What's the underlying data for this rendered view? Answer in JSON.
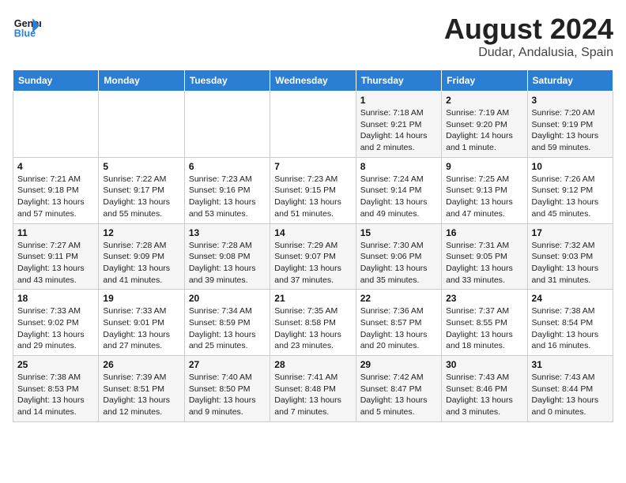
{
  "header": {
    "logo_line1": "General",
    "logo_line2": "Blue",
    "month_year": "August 2024",
    "location": "Dudar, Andalusia, Spain"
  },
  "days_of_week": [
    "Sunday",
    "Monday",
    "Tuesday",
    "Wednesday",
    "Thursday",
    "Friday",
    "Saturday"
  ],
  "weeks": [
    [
      {
        "day": "",
        "info": ""
      },
      {
        "day": "",
        "info": ""
      },
      {
        "day": "",
        "info": ""
      },
      {
        "day": "",
        "info": ""
      },
      {
        "day": "1",
        "info": "Sunrise: 7:18 AM\nSunset: 9:21 PM\nDaylight: 14 hours\nand 2 minutes."
      },
      {
        "day": "2",
        "info": "Sunrise: 7:19 AM\nSunset: 9:20 PM\nDaylight: 14 hours\nand 1 minute."
      },
      {
        "day": "3",
        "info": "Sunrise: 7:20 AM\nSunset: 9:19 PM\nDaylight: 13 hours\nand 59 minutes."
      }
    ],
    [
      {
        "day": "4",
        "info": "Sunrise: 7:21 AM\nSunset: 9:18 PM\nDaylight: 13 hours\nand 57 minutes."
      },
      {
        "day": "5",
        "info": "Sunrise: 7:22 AM\nSunset: 9:17 PM\nDaylight: 13 hours\nand 55 minutes."
      },
      {
        "day": "6",
        "info": "Sunrise: 7:23 AM\nSunset: 9:16 PM\nDaylight: 13 hours\nand 53 minutes."
      },
      {
        "day": "7",
        "info": "Sunrise: 7:23 AM\nSunset: 9:15 PM\nDaylight: 13 hours\nand 51 minutes."
      },
      {
        "day": "8",
        "info": "Sunrise: 7:24 AM\nSunset: 9:14 PM\nDaylight: 13 hours\nand 49 minutes."
      },
      {
        "day": "9",
        "info": "Sunrise: 7:25 AM\nSunset: 9:13 PM\nDaylight: 13 hours\nand 47 minutes."
      },
      {
        "day": "10",
        "info": "Sunrise: 7:26 AM\nSunset: 9:12 PM\nDaylight: 13 hours\nand 45 minutes."
      }
    ],
    [
      {
        "day": "11",
        "info": "Sunrise: 7:27 AM\nSunset: 9:11 PM\nDaylight: 13 hours\nand 43 minutes."
      },
      {
        "day": "12",
        "info": "Sunrise: 7:28 AM\nSunset: 9:09 PM\nDaylight: 13 hours\nand 41 minutes."
      },
      {
        "day": "13",
        "info": "Sunrise: 7:28 AM\nSunset: 9:08 PM\nDaylight: 13 hours\nand 39 minutes."
      },
      {
        "day": "14",
        "info": "Sunrise: 7:29 AM\nSunset: 9:07 PM\nDaylight: 13 hours\nand 37 minutes."
      },
      {
        "day": "15",
        "info": "Sunrise: 7:30 AM\nSunset: 9:06 PM\nDaylight: 13 hours\nand 35 minutes."
      },
      {
        "day": "16",
        "info": "Sunrise: 7:31 AM\nSunset: 9:05 PM\nDaylight: 13 hours\nand 33 minutes."
      },
      {
        "day": "17",
        "info": "Sunrise: 7:32 AM\nSunset: 9:03 PM\nDaylight: 13 hours\nand 31 minutes."
      }
    ],
    [
      {
        "day": "18",
        "info": "Sunrise: 7:33 AM\nSunset: 9:02 PM\nDaylight: 13 hours\nand 29 minutes."
      },
      {
        "day": "19",
        "info": "Sunrise: 7:33 AM\nSunset: 9:01 PM\nDaylight: 13 hours\nand 27 minutes."
      },
      {
        "day": "20",
        "info": "Sunrise: 7:34 AM\nSunset: 8:59 PM\nDaylight: 13 hours\nand 25 minutes."
      },
      {
        "day": "21",
        "info": "Sunrise: 7:35 AM\nSunset: 8:58 PM\nDaylight: 13 hours\nand 23 minutes."
      },
      {
        "day": "22",
        "info": "Sunrise: 7:36 AM\nSunset: 8:57 PM\nDaylight: 13 hours\nand 20 minutes."
      },
      {
        "day": "23",
        "info": "Sunrise: 7:37 AM\nSunset: 8:55 PM\nDaylight: 13 hours\nand 18 minutes."
      },
      {
        "day": "24",
        "info": "Sunrise: 7:38 AM\nSunset: 8:54 PM\nDaylight: 13 hours\nand 16 minutes."
      }
    ],
    [
      {
        "day": "25",
        "info": "Sunrise: 7:38 AM\nSunset: 8:53 PM\nDaylight: 13 hours\nand 14 minutes."
      },
      {
        "day": "26",
        "info": "Sunrise: 7:39 AM\nSunset: 8:51 PM\nDaylight: 13 hours\nand 12 minutes."
      },
      {
        "day": "27",
        "info": "Sunrise: 7:40 AM\nSunset: 8:50 PM\nDaylight: 13 hours\nand 9 minutes."
      },
      {
        "day": "28",
        "info": "Sunrise: 7:41 AM\nSunset: 8:48 PM\nDaylight: 13 hours\nand 7 minutes."
      },
      {
        "day": "29",
        "info": "Sunrise: 7:42 AM\nSunset: 8:47 PM\nDaylight: 13 hours\nand 5 minutes."
      },
      {
        "day": "30",
        "info": "Sunrise: 7:43 AM\nSunset: 8:46 PM\nDaylight: 13 hours\nand 3 minutes."
      },
      {
        "day": "31",
        "info": "Sunrise: 7:43 AM\nSunset: 8:44 PM\nDaylight: 13 hours\nand 0 minutes."
      }
    ]
  ]
}
